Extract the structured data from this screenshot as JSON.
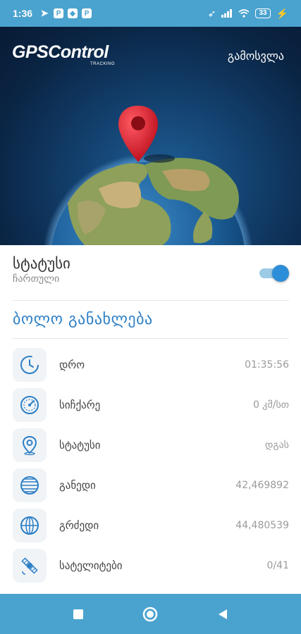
{
  "statusbar": {
    "time": "1:36",
    "notifications": [
      "P",
      "P"
    ],
    "battery": "33"
  },
  "header": {
    "logo": "GPSControl",
    "logo_sub": "TRACKING",
    "logout_label": "გამოსვლა"
  },
  "status": {
    "title": "სტატუსი",
    "subtitle": "ჩართული",
    "toggle_on": true
  },
  "section": {
    "title": "ბოლო განახლება"
  },
  "rows": [
    {
      "icon": "clock-icon",
      "label": "დრო",
      "value": "01:35:56"
    },
    {
      "icon": "speedometer-icon",
      "label": "სიჩქარე",
      "value": "0 კმ/სთ"
    },
    {
      "icon": "location-pin-icon",
      "label": "სტატუსი",
      "value": "დგას"
    },
    {
      "icon": "latitude-globe-icon",
      "label": "განედი",
      "value": "42,469892"
    },
    {
      "icon": "longitude-globe-icon",
      "label": "გრძედი",
      "value": "44,480539"
    },
    {
      "icon": "satellite-icon",
      "label": "სატელიტები",
      "value": "0/41"
    }
  ],
  "colors": {
    "accent": "#2d7fc6",
    "bars": "#4aa3cf",
    "toggle": "#2c8ed8"
  }
}
